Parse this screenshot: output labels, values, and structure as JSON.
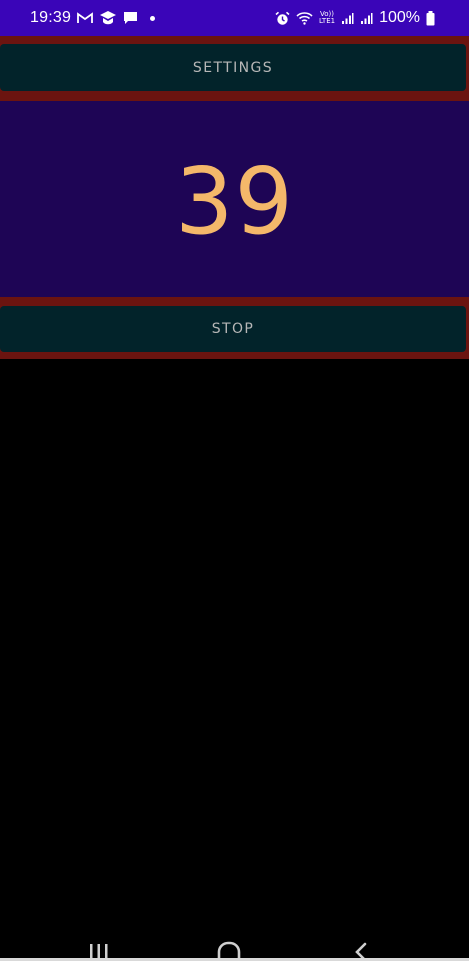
{
  "status_bar": {
    "time": "19:39",
    "battery": "100%",
    "left_icons": [
      "gmail-icon",
      "graduation-cap-icon",
      "chat-icon",
      "notification-dot-icon"
    ],
    "right_icons": [
      "alarm-icon",
      "wifi-calling-icon",
      "volte-icon",
      "signal-icon",
      "signal-icon-2",
      "battery-icon"
    ],
    "volte_top": "Vo))",
    "volte_bottom": "LTE1"
  },
  "settings_button": {
    "label": "SETTINGS"
  },
  "counter": {
    "value": "39"
  },
  "stop_button": {
    "label": "STOP"
  },
  "nav": {
    "recent": "recent-apps-icon",
    "home": "home-icon",
    "back": "back-icon"
  },
  "colors": {
    "status_bar": "#3a05b8",
    "button_bg": "#02232a",
    "button_text": "#b7b7b7",
    "frame_red": "#6b1410",
    "counter_bg": "#1e0555",
    "counter_text": "#f4b86a",
    "background": "#000000"
  }
}
